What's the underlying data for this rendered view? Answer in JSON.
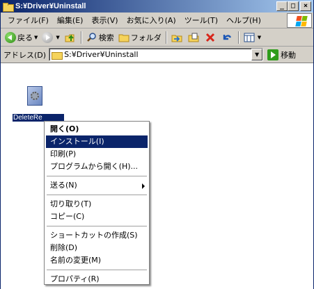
{
  "window": {
    "title": "S:¥Driver¥Uninstall",
    "min": "_",
    "max": "□",
    "close": "×"
  },
  "menubar": {
    "items": [
      "ファイル(F)",
      "編集(E)",
      "表示(V)",
      "お気に入り(A)",
      "ツール(T)",
      "ヘルプ(H)"
    ]
  },
  "toolbar": {
    "back_label": "戻る",
    "search_label": "検索",
    "folders_label": "フォルダ"
  },
  "address": {
    "label": "アドレス(D)",
    "value": "S:¥Driver¥Uninstall",
    "go_label": "移動"
  },
  "file": {
    "name": "DeleteRe"
  },
  "context_menu": {
    "items": [
      {
        "label": "開く(O)"
      },
      {
        "label": "インストール(I)"
      },
      {
        "label": "印刷(P)"
      },
      {
        "label": "プログラムから開く(H)..."
      },
      {
        "label": "送る(N)"
      },
      {
        "label": "切り取り(T)"
      },
      {
        "label": "コピー(C)"
      },
      {
        "label": "ショートカットの作成(S)"
      },
      {
        "label": "削除(D)"
      },
      {
        "label": "名前の変更(M)"
      },
      {
        "label": "プロパティ(R)"
      }
    ]
  },
  "colors": {
    "title_active": "#0a246a",
    "chrome": "#d4d0c8",
    "selection": "#0a246a"
  }
}
